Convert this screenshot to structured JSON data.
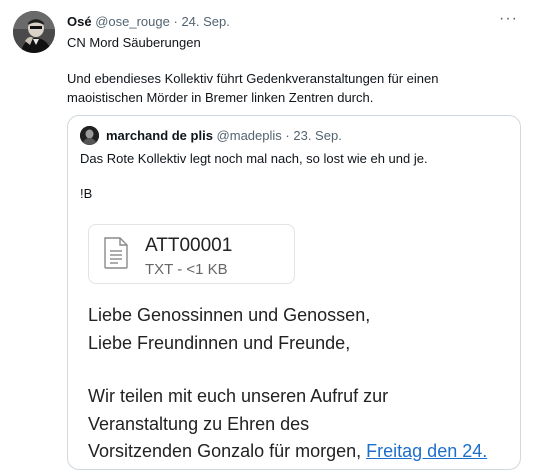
{
  "tweet": {
    "author_name": "Osé",
    "author_handle": "@ose_rouge",
    "separator": "·",
    "date": "24. Sep.",
    "more_label": "···",
    "line1": "CN Mord Säuberungen",
    "line2": "Und ebendieses Kollektiv führt Gedenkveranstaltungen für einen",
    "line3": "maoistischen Mörder in Bremer linken Zentren durch."
  },
  "quoted": {
    "author_name": "marchand de plis",
    "author_handle": "@madeplis",
    "separator": "·",
    "date": "23. Sep.",
    "line1": "Das Rote Kollektiv legt noch mal nach, so lost wie eh und je.",
    "line2": "!B",
    "attachment": {
      "name": "ATT00001",
      "meta": "TXT - <1 KB"
    },
    "email": {
      "line1": "Liebe Genossinnen und Genossen,",
      "line2": "Liebe Freundinnen und Freunde,",
      "line3": "Wir teilen mit euch unseren Aufruf zur",
      "line4": "Veranstaltung zu Ehren des",
      "line5_prefix": "Vorsitzenden Gonzalo für morgen, ",
      "line5_link": "Freitag den 24."
    }
  }
}
